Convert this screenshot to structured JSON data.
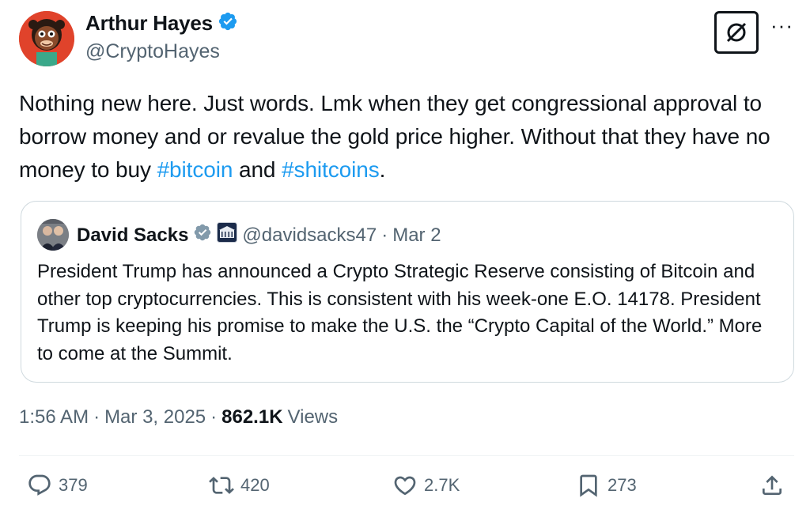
{
  "author": {
    "name": "Arthur Hayes",
    "handle": "@CryptoHayes",
    "verified_icon": "verified-badge-icon",
    "avatar_icon": "cartoon-avatar"
  },
  "header_actions": {
    "grok_icon": "grok-icon",
    "more_label": "···"
  },
  "tweet": {
    "text_part1": "Nothing new here. Just words. Lmk when they get congressional approval to borrow money and or revalue the gold price higher. Without that they have no money to buy ",
    "hashtag1": "#bitcoin",
    "text_part2": " and ",
    "hashtag2": "#shitcoins",
    "text_part3": "."
  },
  "quoted": {
    "name": "David Sacks",
    "handle": "@davidsacks47",
    "separator": "·",
    "date": "Mar 2",
    "text": "President Trump has announced a Crypto Strategic Reserve consisting of Bitcoin and other top cryptocurrencies. This is consistent with his week-one E.O. 14178. President Trump is keeping his promise to make the U.S. the “Crypto Capital of the World.” More to come at the Summit."
  },
  "meta": {
    "time": "1:56 AM",
    "sep1": "·",
    "date": "Mar 3, 2025",
    "sep2": "·",
    "views_count": "862.1K",
    "views_label": "Views"
  },
  "actions": {
    "replies": "379",
    "reposts": "420",
    "likes": "2.7K",
    "bookmarks": "273"
  },
  "colors": {
    "accent": "#1d9bf0",
    "text": "#0f1419",
    "secondary": "#536471",
    "border": "#cfd9de"
  }
}
